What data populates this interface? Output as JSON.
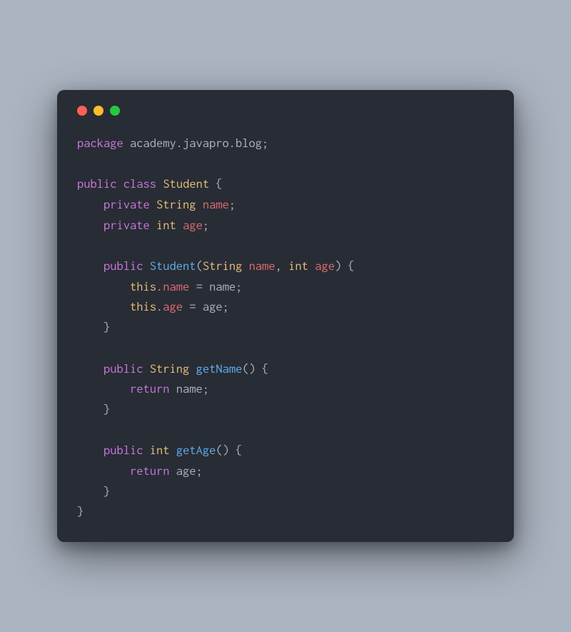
{
  "traffic_lights": {
    "red": "#ff5f56",
    "yellow": "#ffbd2e",
    "green": "#27c93f"
  },
  "code": {
    "line1": {
      "kw_package": "package",
      "pkg_name": " academy.javapro.blog",
      "semicolon": ";"
    },
    "line3": {
      "kw_public": "public",
      "kw_class": "class",
      "class_name": "Student",
      "brace_open": "{"
    },
    "line4": {
      "kw_private": "private",
      "type": "String",
      "var": "name",
      "semicolon": ";"
    },
    "line5": {
      "kw_private": "private",
      "type": "int",
      "var": "age",
      "semicolon": ";"
    },
    "line7": {
      "kw_public": "public",
      "ctor": "Student",
      "paren_open": "(",
      "type1": "String",
      "param1": "name",
      "comma": ",",
      "type2": "int",
      "param2": "age",
      "paren_close": ")",
      "brace_open": "{"
    },
    "line8": {
      "this": "this",
      "dot": ".",
      "field": "name",
      "eq": " = ",
      "val": "name",
      "semicolon": ";"
    },
    "line9": {
      "this": "this",
      "dot": ".",
      "field": "age",
      "eq": " = ",
      "val": "age",
      "semicolon": ";"
    },
    "line10": {
      "brace_close": "}"
    },
    "line12": {
      "kw_public": "public",
      "type": "String",
      "method": "getName",
      "parens": "()",
      "brace_open": "{"
    },
    "line13": {
      "kw_return": "return",
      "val": "name",
      "semicolon": ";"
    },
    "line14": {
      "brace_close": "}"
    },
    "line16": {
      "kw_public": "public",
      "type": "int",
      "method": "getAge",
      "parens": "()",
      "brace_open": "{"
    },
    "line17": {
      "kw_return": "return",
      "val": "age",
      "semicolon": ";"
    },
    "line18": {
      "brace_close": "}"
    },
    "line19": {
      "brace_close": "}"
    }
  }
}
